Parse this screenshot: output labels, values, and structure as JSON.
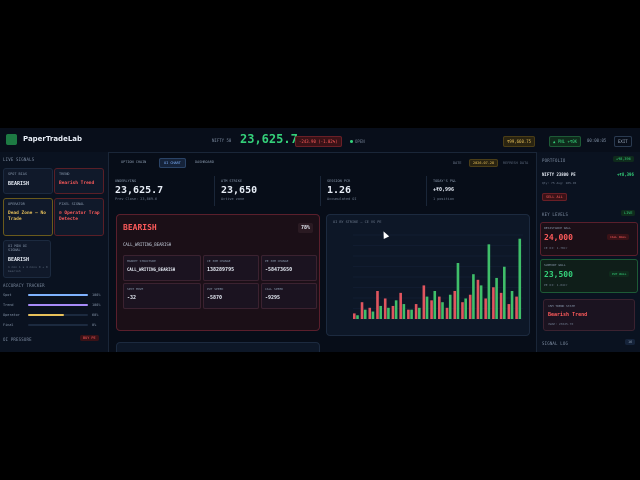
{
  "header": {
    "brand": "PaperTradeLab",
    "index": "NIFTY 50",
    "price": "23,625.7",
    "change": "-243.90 (-1.02%)",
    "open": "OPEN",
    "balance": "₹99,660.75",
    "pnl": "▲ PNL +₹0K",
    "clock": "00:00:05",
    "exit": "EXIT"
  },
  "left": {
    "title": "LIVE SIGNALS",
    "spot": {
      "label": "SPOT BIAS",
      "value": "BEARISH"
    },
    "trend": {
      "label": "TREND",
      "value": "Bearish Trend"
    },
    "operator": {
      "label": "OPERATOR",
      "value": "Dead Zone — No Trade"
    },
    "pixel": {
      "label": "PIXEL SIGNAL",
      "value": "⊘ Operator Trap Detecte"
    },
    "oi": {
      "label": "OI MIN OI SIGNAL",
      "value": "BEARISH",
      "sub": "1 min 1 s 4 mins 0 + 0 bearish"
    },
    "accuracy": {
      "title": "ACCURACY TRACKER",
      "rows": [
        {
          "name": "Spot",
          "val": "100%",
          "pct": 1.0,
          "color": "#7fb3ff"
        },
        {
          "name": "Trend",
          "val": "100%",
          "pct": 1.0,
          "color": "#a78bfa"
        },
        {
          "name": "Operator",
          "val": "60%",
          "pct": 0.6,
          "color": "#e8c15a"
        },
        {
          "name": "Final",
          "val": "0%",
          "pct": 0.0,
          "color": "#34d17a"
        }
      ]
    },
    "pressure": {
      "label": "OI PRESSURE",
      "badge": "BUY PE"
    }
  },
  "main": {
    "tabs": [
      "OPTION CHAIN",
      "OI CHART",
      "DASHBOARD"
    ],
    "date_label": "DATE",
    "date": "2026-07-28",
    "loaded": "REFRESH DATA",
    "stats": [
      {
        "label": "UNDERLYING",
        "value": "23,625.7",
        "sub": "Prev Close: 23,869.6"
      },
      {
        "label": "ATM STRIKE",
        "value": "23,650",
        "sub": "Active zone"
      },
      {
        "label": "SESSION PCR",
        "value": "1.26",
        "sub": "Accumulated OI"
      },
      {
        "label": "TODAY'S P&L",
        "value": "+₹0,996",
        "sub": "1 position"
      }
    ],
    "bias": {
      "title": "BEARISH",
      "conf": "78%",
      "reason": "CALL_WRITING_BEARISH",
      "tiles": [
        {
          "label": "MARKET STRUCTURE",
          "value": "CALL_WRITING_BEARISH"
        },
        {
          "label": "CE 30M CHANGE",
          "value": "138289795"
        },
        {
          "label": "PE 30M CHANGE",
          "value": "-58473650"
        },
        {
          "label": "SPOT MOVE",
          "value": "-32"
        },
        {
          "label": "PUT SPEED",
          "value": "-5870"
        },
        {
          "label": "CALL SPEED",
          "value": "-9295"
        }
      ]
    }
  },
  "chart_data": {
    "type": "bar",
    "title": "OI BY STRIKE — CE VS PE",
    "series": [
      {
        "name": "CE",
        "color": "#e0555f",
        "values": [
          6,
          18,
          12,
          30,
          22,
          14,
          28,
          10,
          16,
          36,
          20,
          24,
          12,
          30,
          18,
          26,
          42,
          22,
          34,
          28,
          16,
          24
        ]
      },
      {
        "name": "PE",
        "color": "#3fbf6a",
        "values": [
          4,
          10,
          8,
          14,
          12,
          20,
          16,
          10,
          12,
          24,
          30,
          18,
          26,
          60,
          22,
          48,
          36,
          80,
          44,
          56,
          30,
          86
        ]
      }
    ]
  },
  "right": {
    "portfolio": {
      "label": "PORTFOLIO",
      "badge": "+₹8,396",
      "pos": "NIFTY 23800 PE",
      "posval": "+₹8,396",
      "sub": "Qty: 75  Avg: 105.45"
    },
    "sell": "SELL ALL",
    "levels": {
      "label": "KEY LEVELS",
      "badge": "LIVE",
      "res": {
        "label": "RESISTANCE WALL",
        "value": "24,000",
        "sub": "CE OI: 1.78Cr",
        "tag": "CALL WALL"
      },
      "sup": {
        "label": "SUPPORT WALL",
        "value": "23,500",
        "sub": "PE OI: 1.04Cr",
        "tag": "PUT WALL"
      }
    },
    "trend": {
      "label": "15M TREND STATE",
      "value": "Bearish Trend",
      "sub": "VWAP: 23625.70"
    },
    "log": {
      "label": "SIGNAL LOG",
      "count": "16"
    }
  }
}
